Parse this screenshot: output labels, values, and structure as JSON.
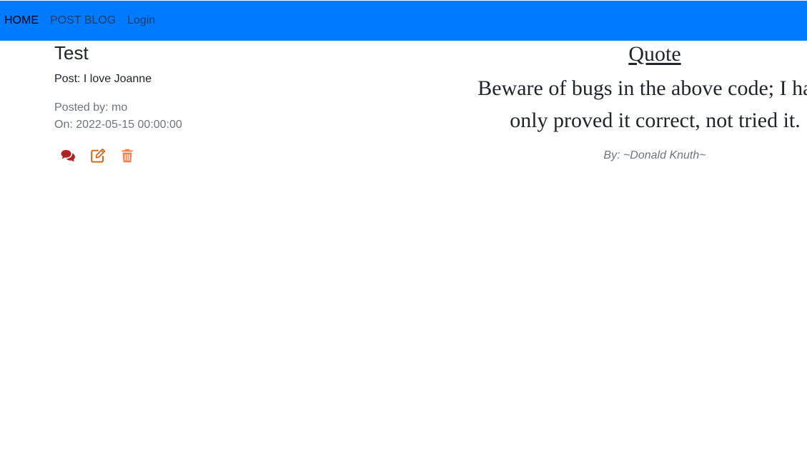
{
  "nav": {
    "items": [
      {
        "label": "HOME"
      },
      {
        "label": "POST BLOG"
      },
      {
        "label": "Login"
      }
    ]
  },
  "post": {
    "title": "Test",
    "body": "Post: I love Joanne",
    "posted_by": "Posted by: mo",
    "posted_on": "On: 2022-05-15 00:00:00",
    "actions": [
      {
        "icon": "comments-icon",
        "color": "#b22222"
      },
      {
        "icon": "edit-icon",
        "color": "#d2691e"
      },
      {
        "icon": "trash-icon",
        "color": "#ff7f50"
      }
    ]
  },
  "quote": {
    "heading": "Quote",
    "text": "Beware of bugs in the above code; I have only proved it correct, not tried it.",
    "author": "By: ~Donald Knuth~"
  },
  "colors": {
    "navbar": "#007bff",
    "nav_link": "#1f3d68",
    "nav_active": "#000000",
    "muted_text": "#6c757d"
  }
}
